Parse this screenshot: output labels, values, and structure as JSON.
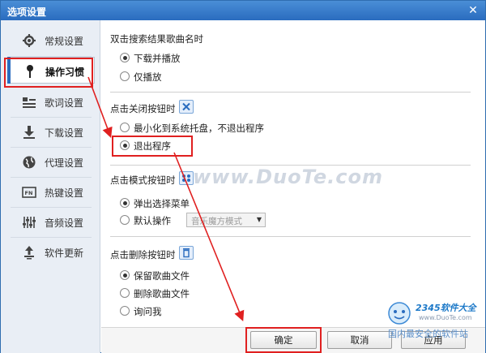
{
  "window": {
    "title": "选项设置",
    "close_glyph": "✕"
  },
  "sidebar": {
    "items": [
      {
        "label": "常规设置",
        "icon": "gear-icon"
      },
      {
        "label": "操作习惯",
        "icon": "pin-icon",
        "active": true
      },
      {
        "label": "歌词设置",
        "icon": "lyrics-icon"
      },
      {
        "label": "下载设置",
        "icon": "download-icon"
      },
      {
        "label": "代理设置",
        "icon": "globe-icon"
      },
      {
        "label": "热键设置",
        "icon": "hotkey-icon"
      },
      {
        "label": "音频设置",
        "icon": "equalizer-icon"
      },
      {
        "label": "软件更新",
        "icon": "update-icon"
      }
    ]
  },
  "sections": {
    "double_click": {
      "title": "双击搜索结果歌曲名时",
      "options": [
        "下载并播放",
        "仅播放"
      ],
      "selected": 0
    },
    "close_button": {
      "title": "点击关闭按钮时",
      "options": [
        "最小化到系统托盘，不退出程序",
        "退出程序"
      ],
      "selected": 1
    },
    "mode_button": {
      "title": "点击模式按钮时",
      "options": [
        "弹出选择菜单",
        "默认操作"
      ],
      "selected": 0,
      "default_select_value": "音乐魔方模式"
    },
    "delete_button": {
      "title": "点击删除按钮时",
      "options": [
        "保留歌曲文件",
        "删除歌曲文件",
        "询问我"
      ],
      "selected": 0
    }
  },
  "footer": {
    "ok": "确定",
    "cancel": "取消",
    "apply": "应用"
  },
  "watermark": {
    "text": "www.DuoTe.com"
  },
  "corner_logo": {
    "brand": "2345软件大全",
    "url": "www.DuoTe.com",
    "slogan": "国内最安全的软件站"
  },
  "colors": {
    "titlebar": "#2a6cbf",
    "accent": "#2a6cbf",
    "highlight": "#e02020"
  }
}
